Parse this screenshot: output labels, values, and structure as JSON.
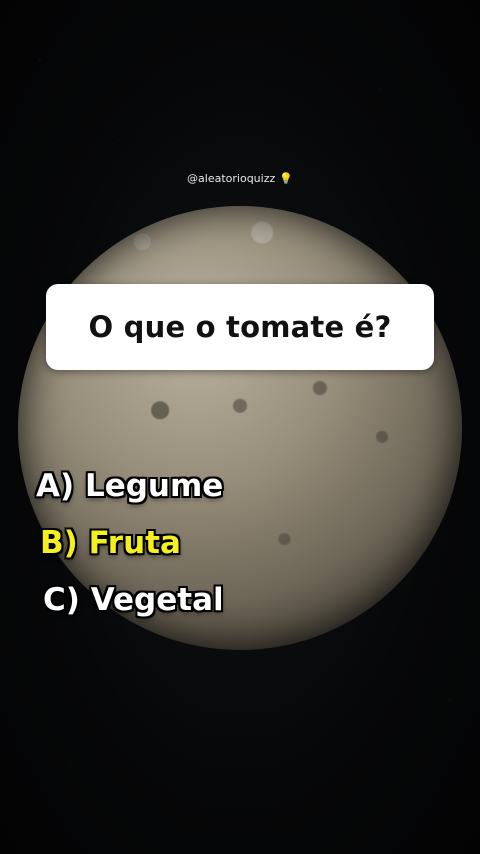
{
  "handle": "@aleatorioquizz",
  "handle_icon": "lightbulb-icon",
  "question": "O que o tomate é?",
  "answers": [
    {
      "label": "A) Legume",
      "highlighted": false,
      "color": "#ffffff"
    },
    {
      "label": "B) Fruta",
      "highlighted": true,
      "color": "#f3f01c"
    },
    {
      "label": "C) Vegetal",
      "highlighted": false,
      "color": "#ffffff"
    }
  ]
}
